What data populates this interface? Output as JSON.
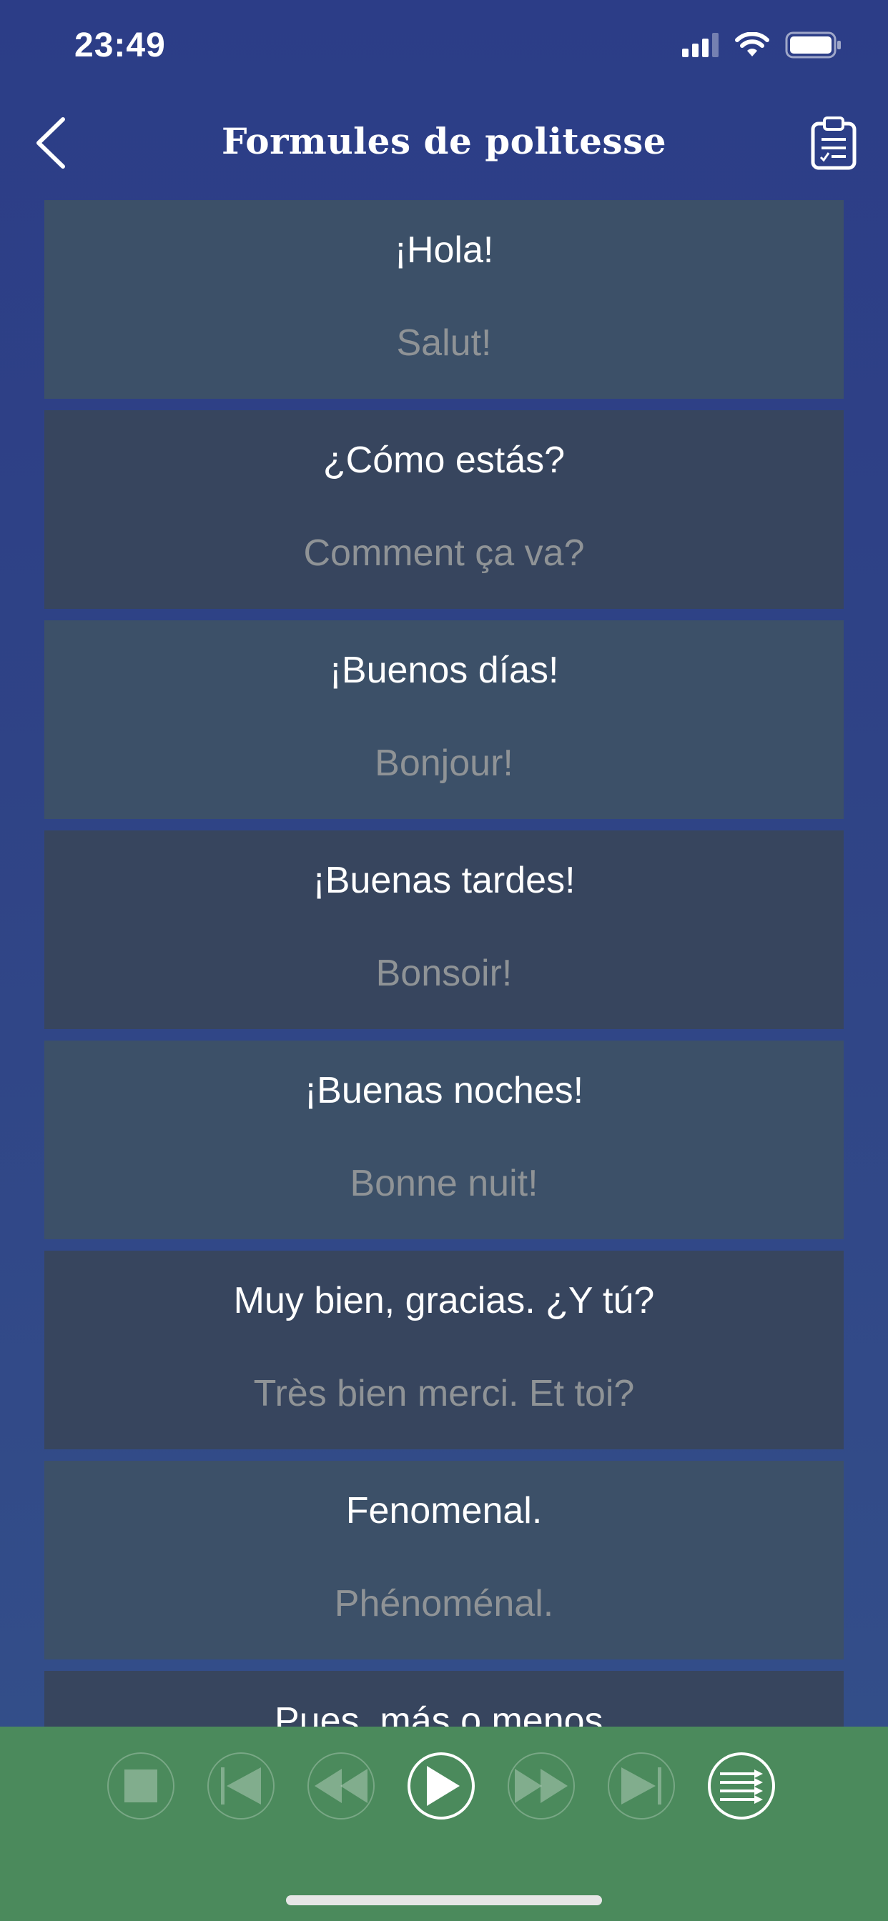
{
  "status": {
    "time": "23:49",
    "icons": [
      "signal-icon",
      "wifi-icon",
      "battery-icon"
    ]
  },
  "header": {
    "title": "Formules de politesse",
    "back_icon": "chevron-left-icon",
    "right_icon": "clipboard-icon"
  },
  "phrases": [
    {
      "es": "¡Hola!",
      "fr": "Salut!"
    },
    {
      "es": "¿Cómo estás?",
      "fr": "Comment ça va?"
    },
    {
      "es": "¡Buenos días!",
      "fr": "Bonjour!"
    },
    {
      "es": "¡Buenas tardes!",
      "fr": "Bonsoir!"
    },
    {
      "es": "¡Buenas noches!",
      "fr": "Bonne nuit!"
    },
    {
      "es": "Muy bien, gracias. ¿Y tú?",
      "fr": "Très bien merci. Et toi?"
    },
    {
      "es": "Fenomenal.",
      "fr": "Phénoménal."
    },
    {
      "es": "Pues, más o menos.",
      "fr": ""
    }
  ],
  "player": {
    "controls": [
      "stop-icon",
      "skip-start-icon",
      "rewind-icon",
      "play-icon",
      "fast-forward-icon",
      "skip-end-icon",
      "playlist-icon"
    ]
  },
  "colors": {
    "background": "#2c3d87",
    "card_light": "#3c5068",
    "card_dark": "#37455e",
    "player_bar": "#4b8a5c",
    "translation_text": "#8f9396"
  }
}
